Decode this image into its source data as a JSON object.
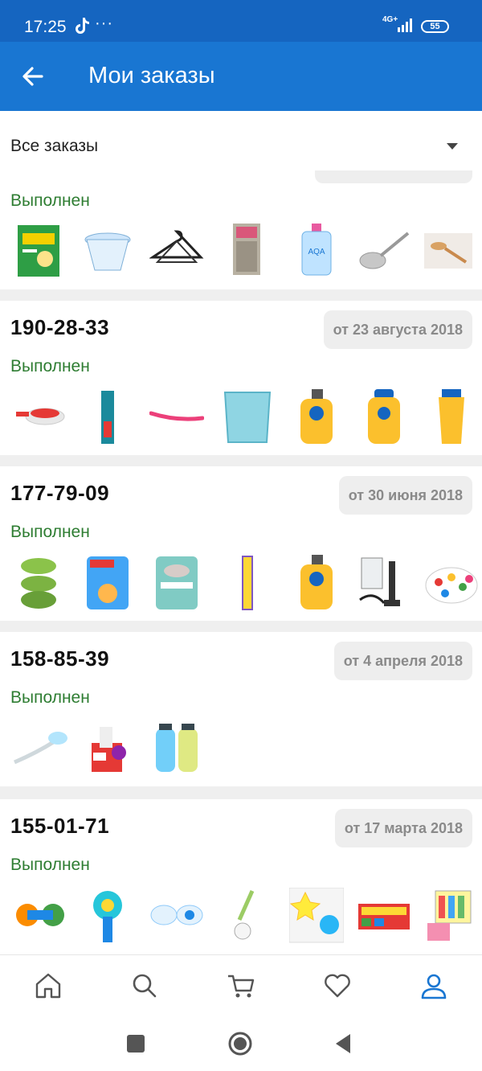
{
  "status_bar": {
    "time": "17:25",
    "dots": "···",
    "network": "4G+",
    "battery": "55"
  },
  "app_bar": {
    "title": "Мои заказы",
    "back_icon": "arrow-left-icon"
  },
  "filter": {
    "label": "Все заказы"
  },
  "orders": [
    {
      "number": "",
      "date": "",
      "status": "Выполнен"
    },
    {
      "number": "190-28-33",
      "date": "от 23 августа 2018",
      "status": "Выполнен"
    },
    {
      "number": "177-79-09",
      "date": "от 30 июня 2018",
      "status": "Выполнен"
    },
    {
      "number": "158-85-39",
      "date": "от 4 апреля 2018",
      "status": "Выполнен"
    },
    {
      "number": "155-01-71",
      "date": "от 17 марта 2018",
      "status": "Выполнен"
    }
  ],
  "bottom_nav": [
    "home-icon",
    "search-icon",
    "cart-icon",
    "heart-icon",
    "profile-icon"
  ],
  "colors": {
    "primary": "#1976d2",
    "status_bar": "#1565c0",
    "status_done": "#2e7d32",
    "active_nav": "#1976d2"
  }
}
